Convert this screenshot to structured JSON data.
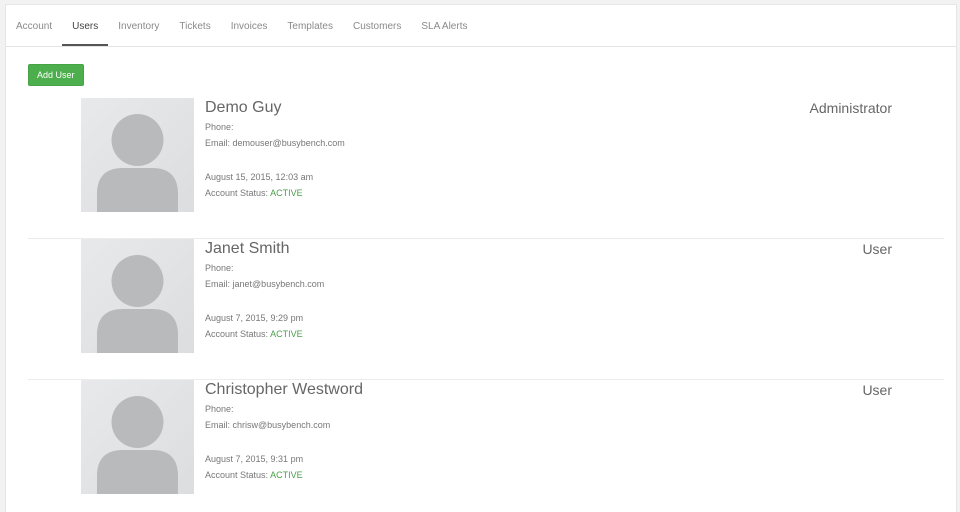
{
  "tabs": [
    {
      "label": "Account",
      "active": false
    },
    {
      "label": "Users",
      "active": true
    },
    {
      "label": "Inventory",
      "active": false
    },
    {
      "label": "Tickets",
      "active": false
    },
    {
      "label": "Invoices",
      "active": false
    },
    {
      "label": "Templates",
      "active": false
    },
    {
      "label": "Customers",
      "active": false
    },
    {
      "label": "SLA Alerts",
      "active": false
    }
  ],
  "toolbar": {
    "add_user_label": "Add User"
  },
  "users": [
    {
      "name": "Demo Guy",
      "phone_label": "Phone:",
      "email_label": "Email:",
      "email": "demouser@busybench.com",
      "date": "August 15, 2015, 12:03 am",
      "status_label": "Account Status:",
      "status": "ACTIVE",
      "role": "Administrator"
    },
    {
      "name": "Janet Smith",
      "phone_label": "Phone:",
      "email_label": "Email:",
      "email": "janet@busybench.com",
      "date": "August 7, 2015, 9:29 pm",
      "status_label": "Account Status:",
      "status": "ACTIVE",
      "role": "User"
    },
    {
      "name": "Christopher Westword",
      "phone_label": "Phone:",
      "email_label": "Email:",
      "email": "chrisw@busybench.com",
      "date": "August 7, 2015, 9:31 pm",
      "status_label": "Account Status:",
      "status": "ACTIVE",
      "role": "User"
    }
  ],
  "colors": {
    "accent": "#4cae4c",
    "status_active": "#4a9e4a"
  },
  "icons": {
    "avatar": "person-silhouette-icon"
  }
}
